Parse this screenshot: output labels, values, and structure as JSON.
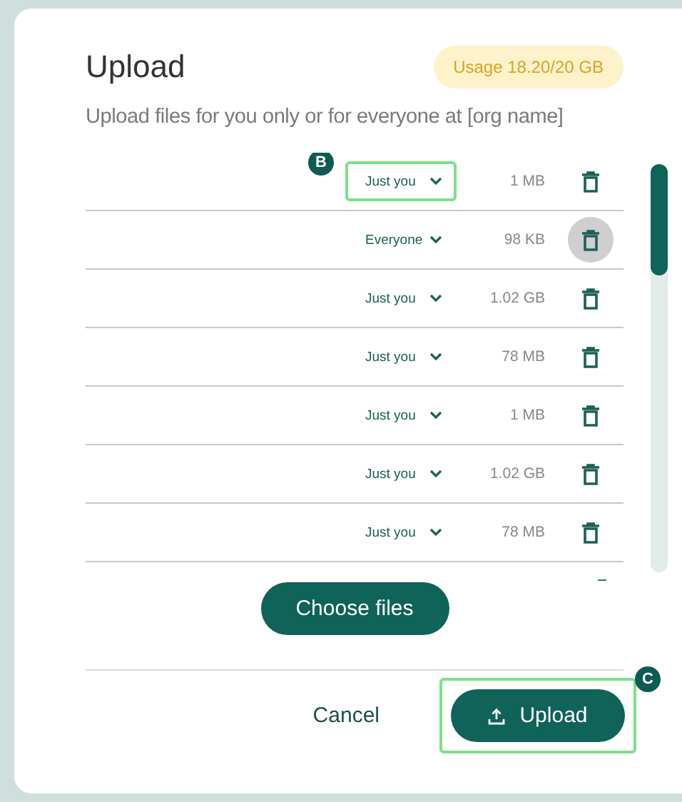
{
  "dialog": {
    "title": "Upload",
    "usage_badge": "Usage 18.20/20 GB",
    "subtitle": "Upload files for you only or for everyone at [org name]"
  },
  "files": [
    {
      "kind": "file",
      "access": "Just you",
      "size": "1 MB",
      "highlighted": true,
      "callout": "B",
      "delete_hovered": false
    },
    {
      "kind": "file",
      "access": "Everyone",
      "size": "98 KB",
      "highlighted": false,
      "delete_hovered": true
    },
    {
      "kind": "file",
      "access": "Just you",
      "size": "1.02 GB",
      "highlighted": false,
      "delete_hovered": false
    },
    {
      "kind": "file",
      "access": "Just you",
      "size": "78 MB",
      "highlighted": false,
      "delete_hovered": false
    },
    {
      "kind": "file",
      "access": "Just you",
      "size": "1 MB",
      "highlighted": false,
      "delete_hovered": false
    },
    {
      "kind": "file",
      "access": "Just you",
      "size": "1.02 GB",
      "highlighted": false,
      "delete_hovered": false
    },
    {
      "kind": "file",
      "access": "Just you",
      "size": "78 MB",
      "highlighted": false,
      "delete_hovered": false
    },
    {
      "kind": "clipped"
    }
  ],
  "choose_button": "Choose files",
  "footer": {
    "cancel": "Cancel",
    "upload": "Upload",
    "upload_highlighted": true,
    "upload_callout": "C"
  }
}
